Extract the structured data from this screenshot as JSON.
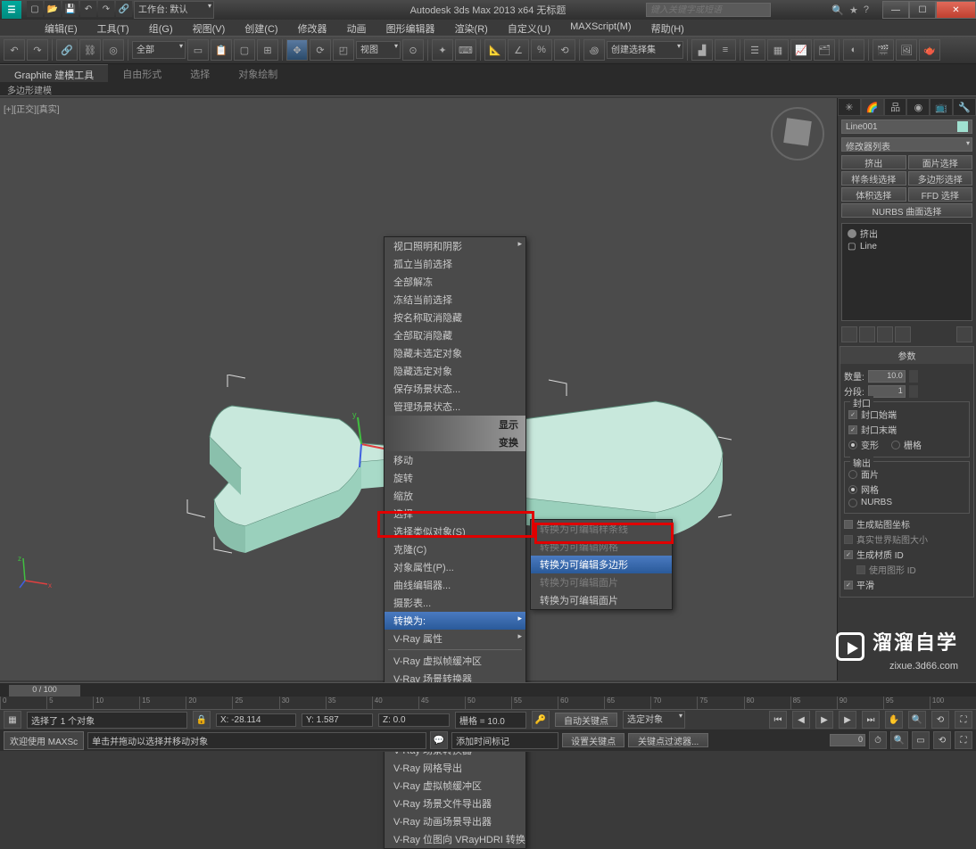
{
  "title": "Autodesk 3ds Max  2013 x64    无标题",
  "search_placeholder": "键入关键字或短语",
  "qat": {
    "workspace_label": "工作台: 默认"
  },
  "menubar": [
    "编辑(E)",
    "工具(T)",
    "组(G)",
    "视图(V)",
    "创建(C)",
    "修改器",
    "动画",
    "图形编辑器",
    "渲染(R)",
    "自定义(U)",
    "MAXScript(M)",
    "帮助(H)"
  ],
  "main_toolbar": {
    "selection_set_label": "全部",
    "named_sel_label": "视图",
    "create_sel_label": "创建选择集"
  },
  "ribbon": {
    "tabs": [
      "Graphite 建模工具",
      "自由形式",
      "选择",
      "对象绘制"
    ],
    "sub": "多边形建模"
  },
  "viewport_label": "[+][正交][真实]",
  "right_panel": {
    "object_name": "Line001",
    "modifier_list_label": "修改器列表",
    "buttons": [
      [
        "挤出",
        "面片选择"
      ],
      [
        "样条线选择",
        "多边形选择"
      ],
      [
        "体积选择",
        "FFD 选择"
      ]
    ],
    "nurbs_btn": "NURBS 曲面选择",
    "stack_items": [
      "挤出",
      "Line"
    ],
    "params_header": "参数",
    "params": {
      "amount_label": "数量:",
      "amount_value": "10.0",
      "segments_label": "分段:",
      "segments_value": "1"
    },
    "cap_group": "封口",
    "cap_start": "封口始端",
    "cap_end": "封口末端",
    "morph": "变形",
    "grid": "栅格",
    "output_group": "输出",
    "output_patch": "面片",
    "output_mesh": "网格",
    "output_nurbs": "NURBS",
    "gen_map": "生成贴图坐标",
    "real_world": "真实世界贴图大小",
    "gen_mat_id": "生成材质 ID",
    "use_shape_id": "使用图形 ID",
    "smooth": "平滑"
  },
  "context_menu": {
    "items": [
      "视口照明和阴影",
      "孤立当前选择",
      "全部解冻",
      "冻结当前选择",
      "按名称取消隐藏",
      "全部取消隐藏",
      "隐藏未选定对象",
      "隐藏选定对象",
      "保存场景状态...",
      "管理场景状态..."
    ],
    "headers": [
      "显示",
      "变换"
    ],
    "items2": [
      "移动",
      "旋转",
      "缩放",
      "选择",
      "选择类似对象(S)",
      "克隆(C)",
      "对象属性(P)...",
      "曲线编辑器...",
      "摄影表..."
    ],
    "convert_label": "转换为:",
    "vray_label": "V-Ray 属性",
    "vray_items": [
      "V-Ray 虚拟帧缓冲区",
      "V-Ray 场景转换器",
      "V-Ray 网格导出",
      "V-Ray 场景文件导出器",
      "V-Ray 属性",
      "V-Ray 场景转换器",
      "V-Ray 网格导出",
      "V-Ray 虚拟帧缓冲区",
      "V-Ray 场景文件导出器",
      "V-Ray 动画场景导出器",
      "V-Ray 位图向 VRayHDRI 转换"
    ],
    "submenu": [
      "转换为可编辑样条线",
      "转换为可编辑网格",
      "转换为可编辑多边形",
      "转换为可编辑面片",
      "转换为可编辑面片"
    ],
    "submenu_highlight_idx": 2
  },
  "timeline": {
    "current": "0 / 100",
    "ticks": [
      "0",
      "5",
      "10",
      "15",
      "20",
      "25",
      "30",
      "35",
      "40",
      "45",
      "50",
      "55",
      "60",
      "65",
      "70",
      "75",
      "80",
      "85",
      "90",
      "95",
      "100"
    ]
  },
  "status": {
    "selection": "选择了 1 个对象",
    "hint": "单击并拖动以选择并移动对象",
    "x": "X: -28.114",
    "y": "Y: 1.587",
    "z": "Z: 0.0",
    "grid": "栅格 = 10.0",
    "autokey": "自动关键点",
    "selected": "选定对象",
    "setkey": "设置关键点",
    "keyfilter": "关键点过滤器...",
    "addtime": "添加时间标记",
    "welcome": "欢迎使用 MAXSc"
  },
  "watermark": {
    "main": "溜溜自学",
    "sub": "zixue.3d66.com"
  }
}
